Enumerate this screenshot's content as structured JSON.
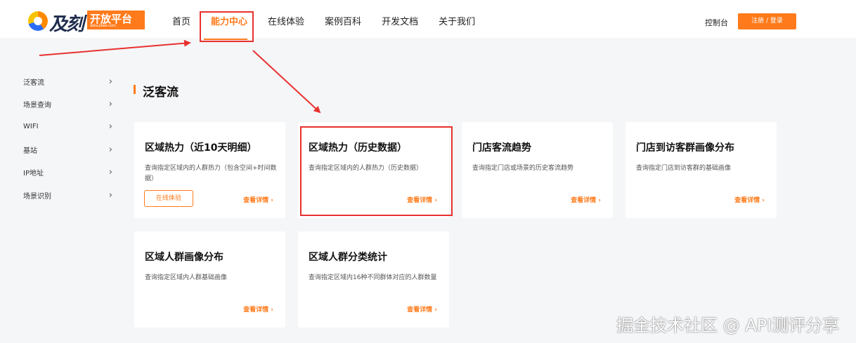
{
  "logo": {
    "brand": "及刻",
    "platform": "开放平台",
    "domain": "data.jikee.com"
  },
  "nav": {
    "items": [
      {
        "label": "首页",
        "active": false
      },
      {
        "label": "能力中心",
        "active": true
      },
      {
        "label": "在线体验",
        "active": false
      },
      {
        "label": "案例百科",
        "active": false
      },
      {
        "label": "开发文档",
        "active": false
      },
      {
        "label": "关于我们",
        "active": false
      }
    ],
    "console": "控制台",
    "login": "注册 / 登录"
  },
  "sidebar": {
    "items": [
      {
        "label": "泛客流"
      },
      {
        "label": "场景查询"
      },
      {
        "label": "WIFI"
      },
      {
        "label": "基站"
      },
      {
        "label": "IP地址"
      },
      {
        "label": "场景识别"
      }
    ],
    "chevron": "›"
  },
  "section": {
    "title": "泛客流"
  },
  "cards": [
    {
      "title": "区域热力（近10天明细）",
      "desc": "查询指定区域内的人群热力（包含空间+时间数据）",
      "try_label": "在线体验",
      "link": "查看详情 ›"
    },
    {
      "title": "区域热力（历史数据）",
      "desc": "查询指定区域内的人群热力（历史数据）",
      "link": "查看详情 ›"
    },
    {
      "title": "门店客流趋势",
      "desc": "查询指定门店或场景的历史客流趋势",
      "link": "查看详情 ›"
    },
    {
      "title": "门店到访客群画像分布",
      "desc": "查询指定门店到访客群的基础画像",
      "link": "查看详情 ›"
    },
    {
      "title": "区域人群画像分布",
      "desc": "查询指定区域内人群基础画像",
      "link": "查看详情 ›"
    },
    {
      "title": "区域人群分类统计",
      "desc": "查询指定区域内16种不同群体对应的人群数量",
      "link": "查看详情 ›"
    }
  ],
  "watermark": "掘金技术社区 @ API测评分享",
  "colors": {
    "accent": "#ff7a1a",
    "annotation": "#e8312f",
    "background": "#f5f6f8"
  }
}
